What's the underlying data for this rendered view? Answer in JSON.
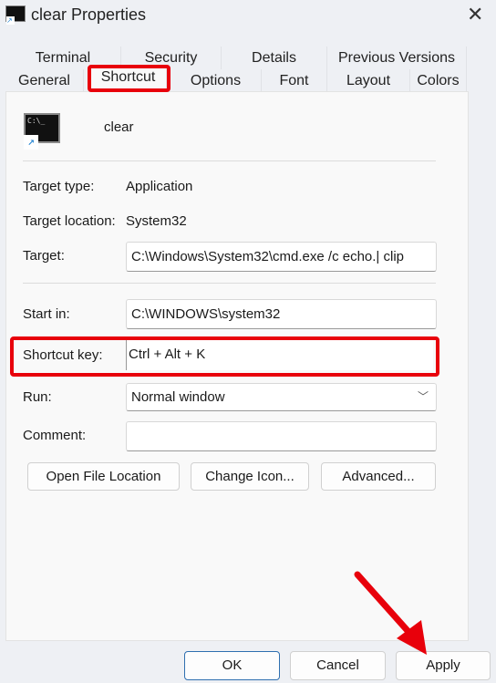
{
  "window": {
    "title": "clear  Properties",
    "close_icon": "close-icon",
    "app_icon": "cmd-shortcut-icon"
  },
  "tabs": {
    "row1": [
      "Terminal",
      "Security",
      "Details",
      "Previous Versions"
    ],
    "row2": [
      "General",
      "Shortcut",
      "Options",
      "Font",
      "Layout",
      "Colors"
    ],
    "active": "Shortcut"
  },
  "shortcut": {
    "name": "clear",
    "target_type_label": "Target type:",
    "target_type": "Application",
    "target_location_label": "Target location:",
    "target_location": "System32",
    "target_label": "Target:",
    "target": "C:\\Windows\\System32\\cmd.exe /c echo.| clip",
    "start_in_label": "Start in:",
    "start_in": "C:\\WINDOWS\\system32",
    "shortcut_key_label": "Shortcut key:",
    "shortcut_key": "Ctrl + Alt + K",
    "run_label": "Run:",
    "run": "Normal window",
    "comment_label": "Comment:",
    "comment": "",
    "open_file_location": "Open File Location",
    "change_icon": "Change Icon...",
    "advanced": "Advanced..."
  },
  "footer": {
    "ok": "OK",
    "cancel": "Cancel",
    "apply": "Apply"
  },
  "annotation_color": "#e8000b"
}
